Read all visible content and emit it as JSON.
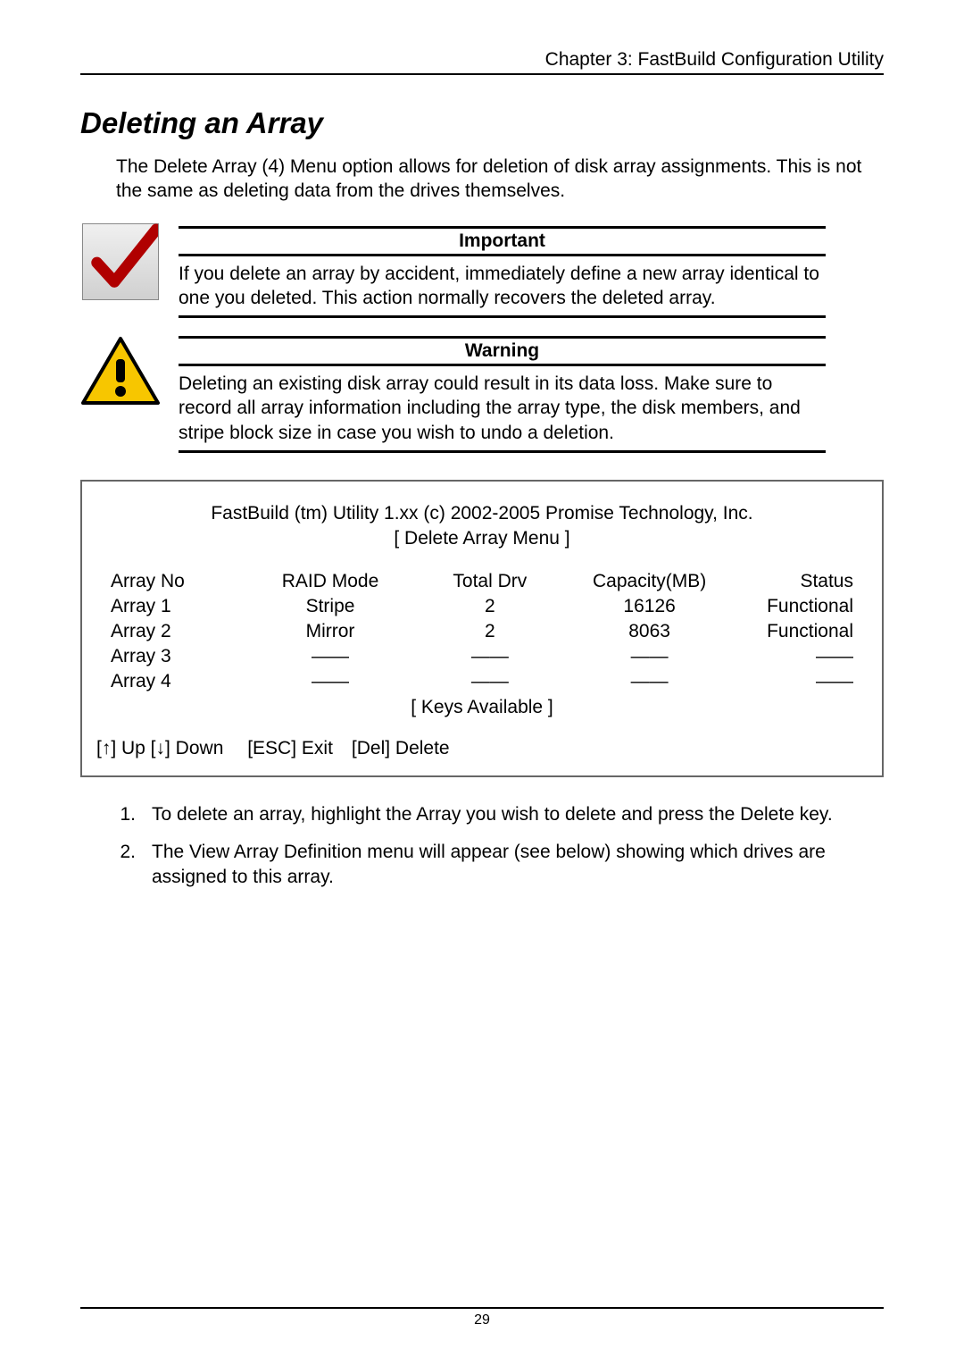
{
  "header": {
    "chapter": "Chapter 3: FastBuild Configuration Utility"
  },
  "section": {
    "title": "Deleting an Array",
    "intro": "The Delete Array (4) Menu option allows for deletion of disk array assignments. This is not the same as deleting data from the drives themselves."
  },
  "callouts": {
    "important": {
      "title": "Important",
      "text": "If you delete an array by accident, immediately define a new array identical to one you deleted. This action normally recovers the deleted array."
    },
    "warning": {
      "title": "Warning",
      "text": "Deleting an existing disk array could result in its data loss. Make sure to record all array information including the array type, the disk members, and stripe block size in case you wish to undo a deletion."
    }
  },
  "bios": {
    "line1": "FastBuild (tm) Utility 1.xx (c) 2002-2005 Promise Technology, Inc.",
    "line2": "[ Delete Array Menu ]",
    "columns": [
      "Array No",
      "RAID Mode",
      "Total Drv",
      "Capacity(MB)",
      "Status"
    ],
    "rows": [
      [
        "Array 1",
        "Stripe",
        "2",
        "16126",
        "Functional"
      ],
      [
        "Array 2",
        "Mirror",
        "2",
        "8063",
        "Functional"
      ],
      [
        "Array 3",
        "——",
        "——",
        "——",
        "——"
      ],
      [
        "Array 4",
        "——",
        "——",
        "——",
        "——"
      ]
    ],
    "keys_title": "[ Keys Available ]",
    "keys": "[↑] Up [↓] Down  [ESC] Exit [Del] Delete"
  },
  "steps": [
    {
      "num": "1.",
      "text": "To delete an array, highlight the Array you wish to delete and press the Delete key."
    },
    {
      "num": "2.",
      "text": "The View Array Definition menu will appear (see below) showing which drives are assigned to this array."
    }
  ],
  "footer": {
    "page_number": "29"
  }
}
